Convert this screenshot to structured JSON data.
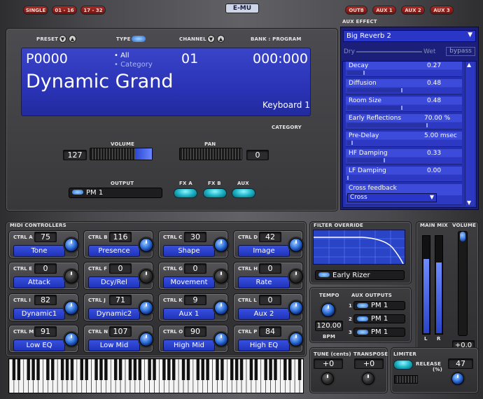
{
  "header": {
    "tabs": [
      "SINGLE",
      "01 - 16",
      "17 - 32"
    ],
    "brand": "E-MU",
    "out_buttons": [
      "OUT8",
      "AUX 1",
      "AUX 2",
      "AUX 3"
    ]
  },
  "preset": {
    "preset_label": "PRESET",
    "type_label": "TYPE",
    "channel_label": "CHANNEL",
    "bank_label": "BANK : PROGRAM",
    "number": "P0000",
    "filter_all": "• All",
    "filter_category": "• Category",
    "channel": "01",
    "bank_program": "000:000",
    "name": "Dynamic Grand",
    "category_value": "Keyboard 1",
    "category_label": "CATEGORY"
  },
  "mix": {
    "volume_label": "VOLUME",
    "volume": "127",
    "pan_label": "PAN",
    "pan": "0",
    "output_label": "OUTPUT",
    "output": "PM 1",
    "fx_a": "FX A",
    "fx_b": "FX B",
    "aux": "AUX"
  },
  "aux_effect": {
    "label": "AUX EFFECT",
    "preset": "Big Reverb 2",
    "dry": "Dry",
    "wet": "Wet",
    "bypass": "bypass",
    "params": [
      {
        "name": "Decay",
        "value": "0.27",
        "level": 0.15
      },
      {
        "name": "Diffusion",
        "value": "0.48",
        "level": 0.48
      },
      {
        "name": "Room Size",
        "value": "0.48",
        "level": 0.48
      },
      {
        "name": "Early Reflections",
        "value": "70.00 %",
        "level": 0.7
      },
      {
        "name": "Pre-Delay",
        "value": "5.00 msec",
        "level": 0.05
      },
      {
        "name": "HF Damping",
        "value": "0.33",
        "level": 0.33
      },
      {
        "name": "LF Damping",
        "value": "0.00",
        "level": 0.0
      }
    ],
    "cross_feedback": "Cross feedback",
    "cross_value": "Cross"
  },
  "midi": {
    "label": "MIDI CONTROLLERS",
    "controllers": [
      {
        "id": "CTRL A",
        "value": "75",
        "name": "Tone"
      },
      {
        "id": "CTRL B",
        "value": "116",
        "name": "Presence"
      },
      {
        "id": "CTRL C",
        "value": "30",
        "name": "Shape"
      },
      {
        "id": "CTRL D",
        "value": "42",
        "name": "Image"
      },
      {
        "id": "CTRL E",
        "value": "0",
        "name": "Attack"
      },
      {
        "id": "CTRL F",
        "value": "0",
        "name": "Dcy/Rel"
      },
      {
        "id": "CTRL G",
        "value": "0",
        "name": "Movement"
      },
      {
        "id": "CTRL H",
        "value": "0",
        "name": "Rate"
      },
      {
        "id": "CTRL I",
        "value": "82",
        "name": "Dynamic1"
      },
      {
        "id": "CTRL J",
        "value": "71",
        "name": "Dynamic2"
      },
      {
        "id": "CTRL K",
        "value": "9",
        "name": "Aux 1"
      },
      {
        "id": "CTRL L",
        "value": "0",
        "name": "Aux 2"
      },
      {
        "id": "CTRL M",
        "value": "91",
        "name": "Low EQ"
      },
      {
        "id": "CTRL N",
        "value": "107",
        "name": "Low Mid"
      },
      {
        "id": "CTRL O",
        "value": "90",
        "name": "High Mid"
      },
      {
        "id": "CTRL P",
        "value": "84",
        "name": "High EQ"
      }
    ]
  },
  "filter": {
    "label": "FILTER OVERRIDE",
    "type": "Early Rizer"
  },
  "tempo": {
    "label": "TEMPO",
    "value": "120.00",
    "unit": "BPM"
  },
  "aux_outputs": {
    "label": "AUX OUTPUTS",
    "items": [
      "PM 1",
      "PM 1",
      "PM 1"
    ],
    "numbers": [
      "1",
      "2",
      "3"
    ]
  },
  "main_mix": {
    "main_label": "MAIN MIX",
    "volume_label": "VOLUME",
    "l": "L",
    "r": "R",
    "value": "+0.0"
  },
  "bottom": {
    "tune_label": "TUNE (cents)",
    "tune": "+0",
    "transpose_label": "TRANSPOSE",
    "transpose": "+0",
    "limiter_label": "LIMITER",
    "release_label": "RELEASE",
    "release_unit": "(%)",
    "release": "47"
  }
}
